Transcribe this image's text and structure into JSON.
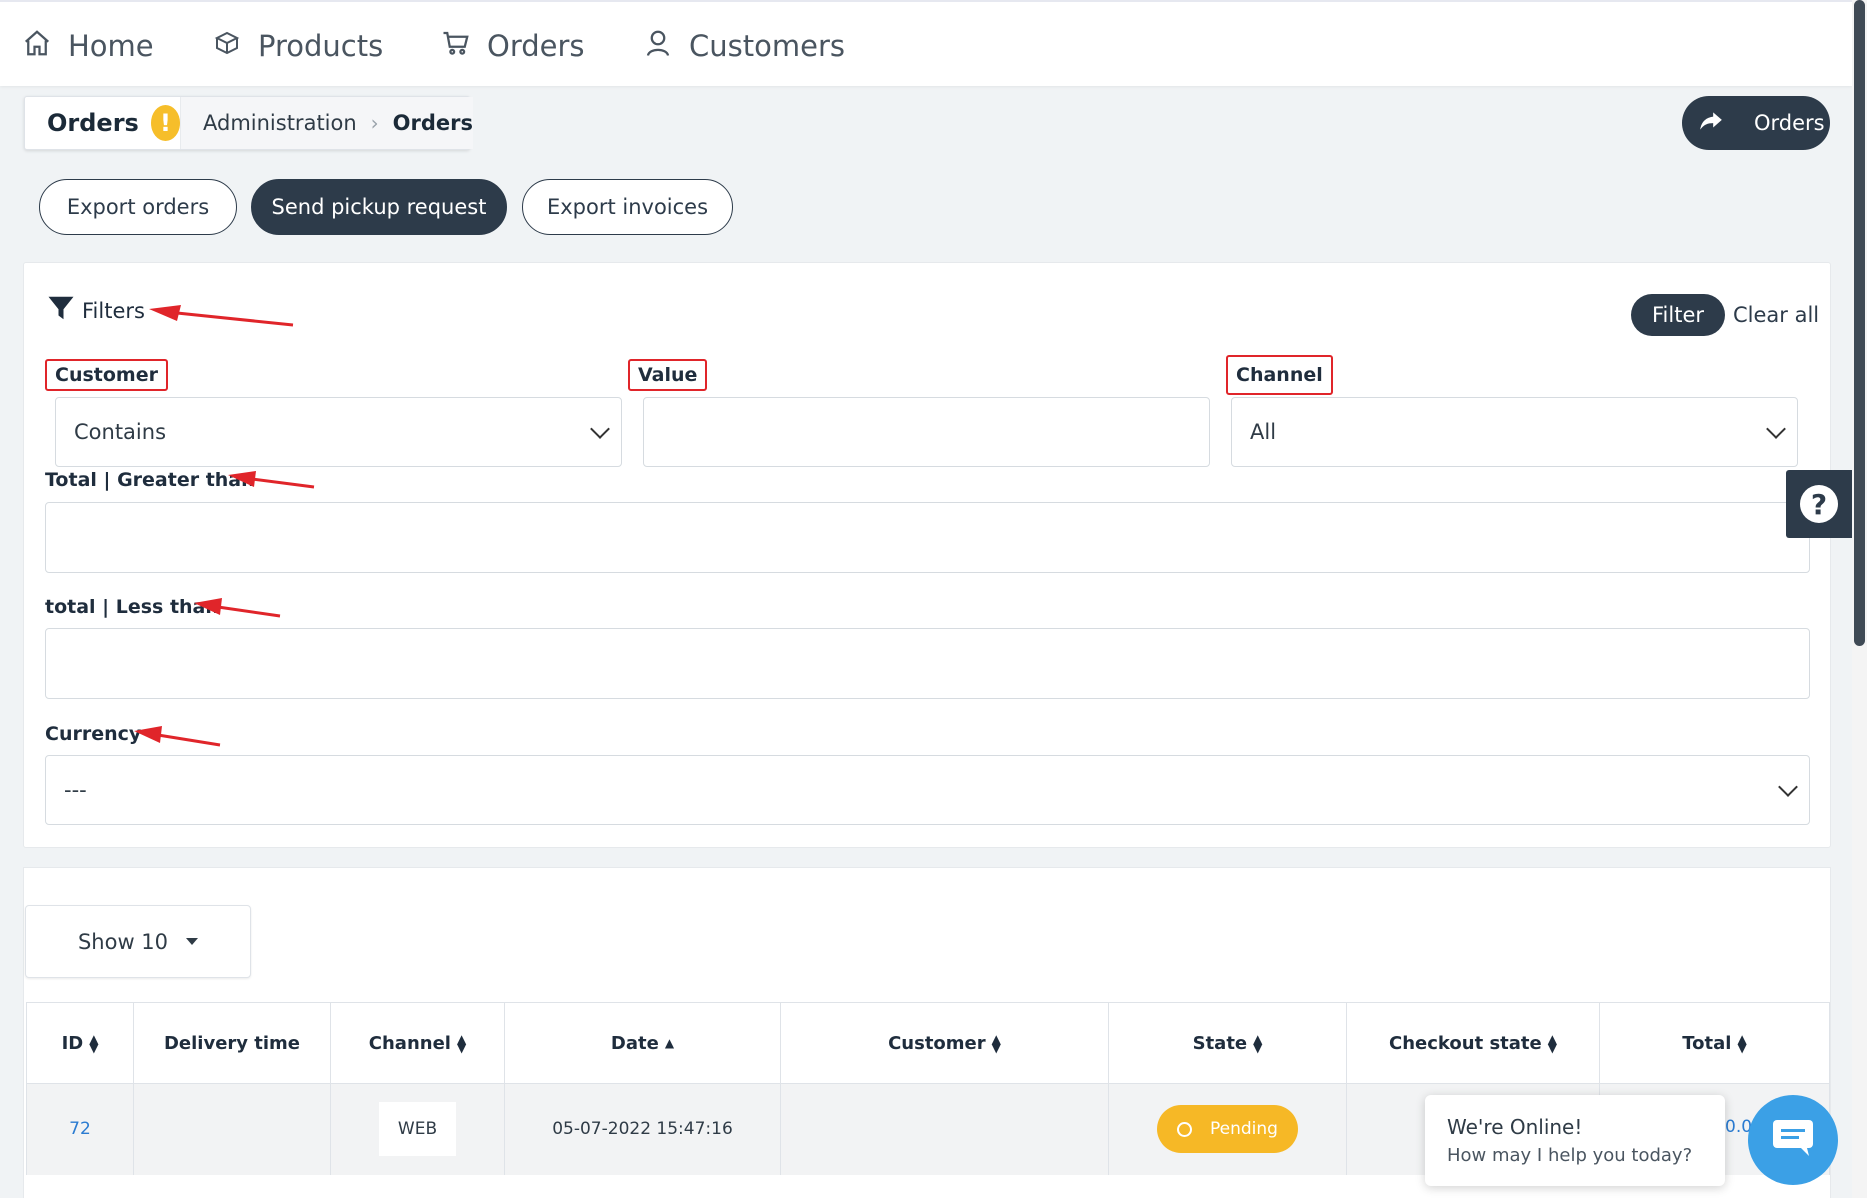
{
  "nav": {
    "items": [
      {
        "label": "Home",
        "icon": "home-icon"
      },
      {
        "label": "Products",
        "icon": "box-icon"
      },
      {
        "label": "Orders",
        "icon": "cart-icon"
      },
      {
        "label": "Customers",
        "icon": "user-icon"
      }
    ]
  },
  "header": {
    "title": "Orders",
    "warning_badge": "!",
    "breadcrumb": [
      "Administration",
      "Orders"
    ],
    "orders_link_label": "Orders"
  },
  "actions": {
    "export_orders": "Export orders",
    "send_pickup": "Send pickup request",
    "export_invoices": "Export invoices"
  },
  "filters": {
    "title": "Filters",
    "filter_button": "Filter",
    "clear_all": "Clear all",
    "customer_label": "Customer",
    "customer_value": "Contains",
    "value_label": "Value",
    "value_value": "",
    "channel_label": "Channel",
    "channel_value": "All",
    "total_gt_label": "Total | Greater than",
    "total_lt_label": "total | Less than",
    "currency_label": "Currency",
    "currency_value": "---"
  },
  "table": {
    "show_label": "Show 10",
    "columns": [
      "ID",
      "Delivery time",
      "Channel",
      "Date",
      "Customer",
      "State",
      "Checkout state",
      "Total"
    ],
    "rows": [
      {
        "id": "72",
        "delivery_time": "",
        "channel": "WEB",
        "date": "05-07-2022 15:47:16",
        "customer": "",
        "state": "Pending",
        "checkout_state": "",
        "total": "0.0"
      }
    ]
  },
  "chat": {
    "line1": "We're Online!",
    "line2": "How may I help you today?"
  },
  "help": {
    "label": "?"
  },
  "colors": {
    "accent_dark": "#2d3b4a",
    "warning": "#f6be2a",
    "highlight": "#e0252a",
    "link": "#2a7bd1",
    "chat": "#3ba0e6"
  }
}
